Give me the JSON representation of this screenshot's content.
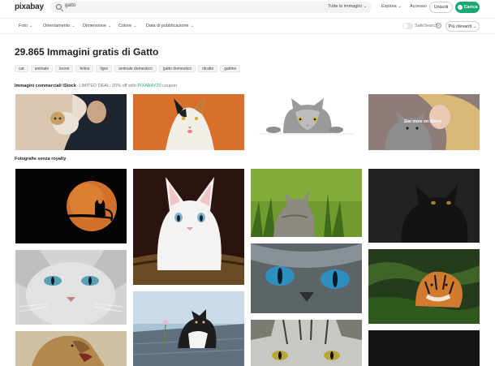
{
  "header": {
    "logo": "pixabay",
    "search_value": "gatto",
    "search_filter": "Tutte le immagini",
    "nav": {
      "explore": "Esplora",
      "login": "Accesso",
      "join": "Unisciti",
      "upload": "Carica"
    }
  },
  "filters": {
    "items": [
      "Foto",
      "Orientamento",
      "Dimensione",
      "Colore",
      "Data di pubblicazione"
    ],
    "safesearch": "SafeSearch",
    "sort": "Più rilevanti"
  },
  "main": {
    "title": "29.865 Immagini gratis di Gatto",
    "tags": [
      "cat",
      "animale",
      "leone",
      "felino",
      "tigre",
      "animale domestico",
      "gatto domestico",
      "ritratto",
      "gattino"
    ],
    "istock": {
      "title": "Immagini commerciali iStock",
      "promo": "LIMITED DEAL: 20% off with",
      "code": "PIXABAY20",
      "promo_end": "coupon",
      "see_more": "See more on iStock"
    },
    "royalty_free_title": "Fotografie senza royalty"
  },
  "colors": {
    "accent": "#19a974",
    "text": "#2c2c2c",
    "tag_bg": "#f4f4f4"
  }
}
